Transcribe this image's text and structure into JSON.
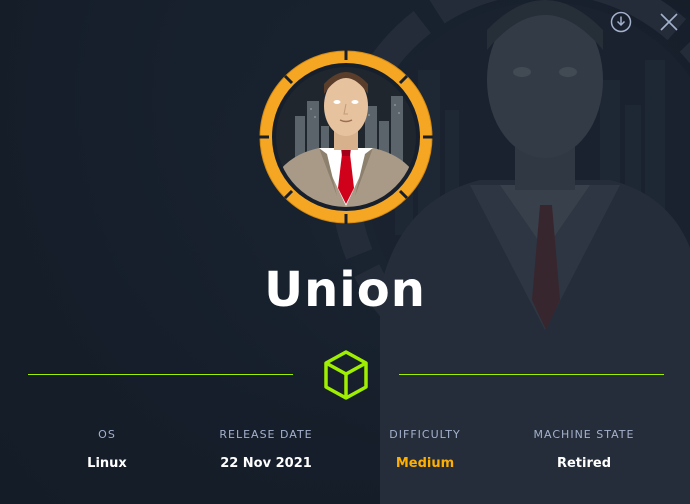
{
  "machine": {
    "name": "Union",
    "avatar_icon": "businessman-avatar",
    "type_icon": "cube-icon"
  },
  "toolbar": {
    "download_icon": "download-icon",
    "close_icon": "close-icon"
  },
  "stats": {
    "os": {
      "label": "OS",
      "value": "Linux"
    },
    "release_date": {
      "label": "RELEASE DATE",
      "value": "22 Nov 2021"
    },
    "difficulty": {
      "label": "DIFFICULTY",
      "value": "Medium"
    },
    "machine_state": {
      "label": "MACHINE STATE",
      "value": "Retired"
    }
  },
  "colors": {
    "background": "#161f2b",
    "accent_green": "#9fef00",
    "avatar_ring": "#f5a623",
    "difficulty_medium": "#ffaf00",
    "label_grey": "#a4b1cd",
    "value_white": "#ffffff"
  }
}
